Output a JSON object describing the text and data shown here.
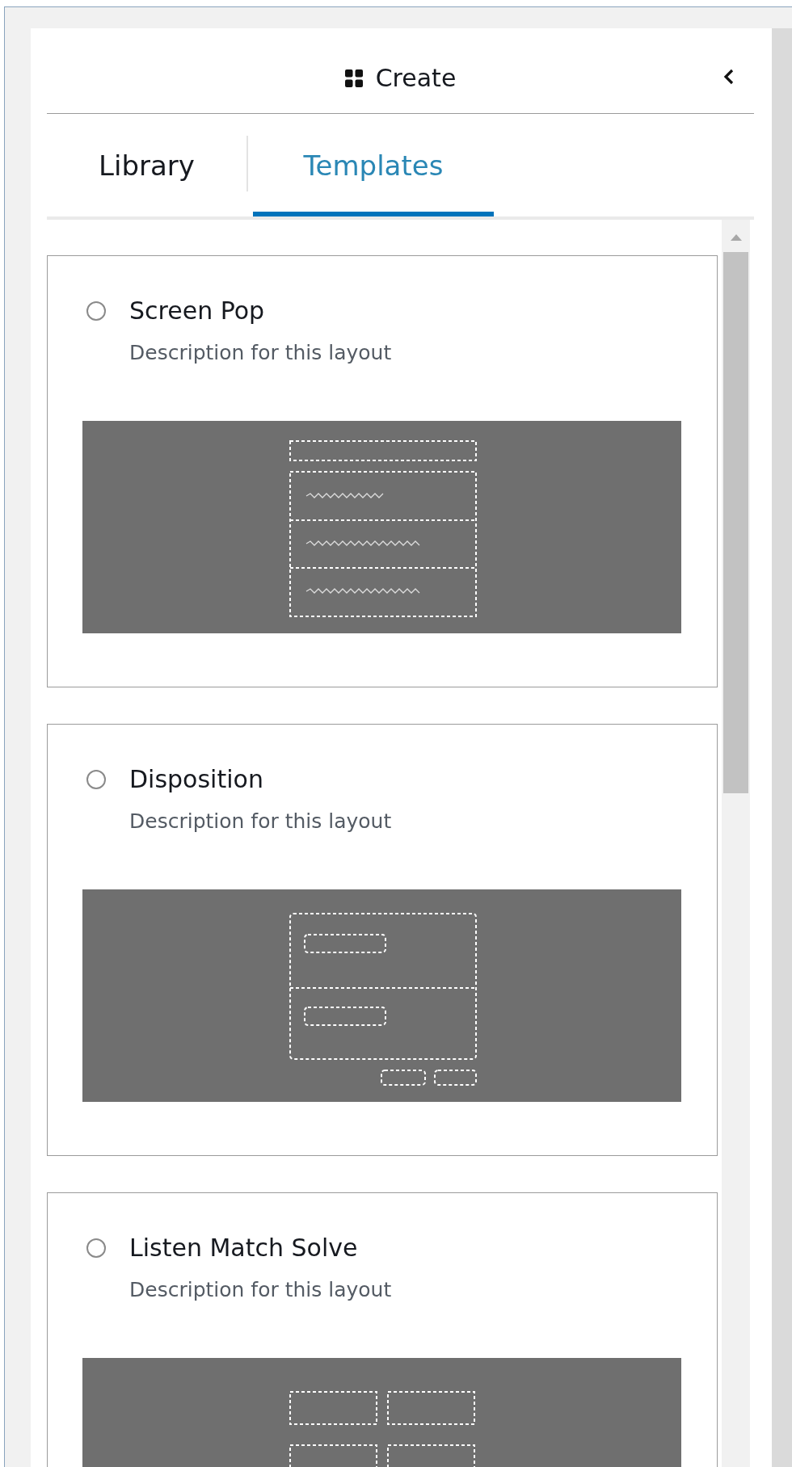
{
  "header": {
    "title": "Create"
  },
  "tabs": [
    {
      "label": "Library",
      "selected": false
    },
    {
      "label": "Templates",
      "selected": true
    }
  ],
  "templates": [
    {
      "kind": "screen-pop",
      "title": "Screen Pop",
      "description": "Description for this layout",
      "selected": false
    },
    {
      "kind": "disposition",
      "title": "Disposition",
      "description": "Description for this layout",
      "selected": false
    },
    {
      "kind": "grid",
      "title": "Listen Match Solve",
      "description": "Description for this layout",
      "selected": false
    }
  ]
}
